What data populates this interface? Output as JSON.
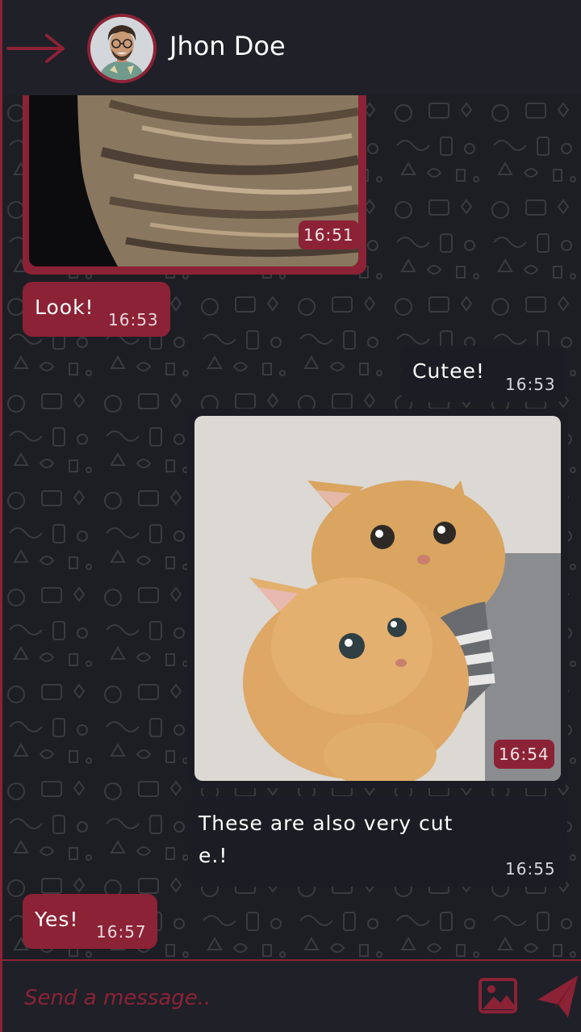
{
  "header": {
    "contact_name": "Jhon Doe",
    "back_icon": "arrow-right-icon",
    "avatar": "avatar-man-curly-hair"
  },
  "colors": {
    "accent": "#8c2236",
    "background": "#1b1c22",
    "header_bg": "#1f2028",
    "outgoing_bubble": "#1c1d24"
  },
  "messages": [
    {
      "type": "image",
      "direction": "incoming",
      "content": "cat-fur-closeup",
      "time": "16:51"
    },
    {
      "type": "text",
      "direction": "incoming",
      "text": "Look!",
      "time": "16:53"
    },
    {
      "type": "text",
      "direction": "outgoing",
      "text": "Cutee!",
      "time": "16:53"
    },
    {
      "type": "image",
      "direction": "outgoing",
      "content": "two-orange-kittens",
      "time": "16:54"
    },
    {
      "type": "text",
      "direction": "outgoing",
      "text_lines": [
        "These are also very cut",
        "e.!"
      ],
      "time": "16:55"
    },
    {
      "type": "text",
      "direction": "incoming",
      "text": "Yes!",
      "time": "16:57"
    }
  ],
  "composer": {
    "placeholder": "Send a message..",
    "attach_icon": "image-icon",
    "send_icon": "send-icon"
  }
}
